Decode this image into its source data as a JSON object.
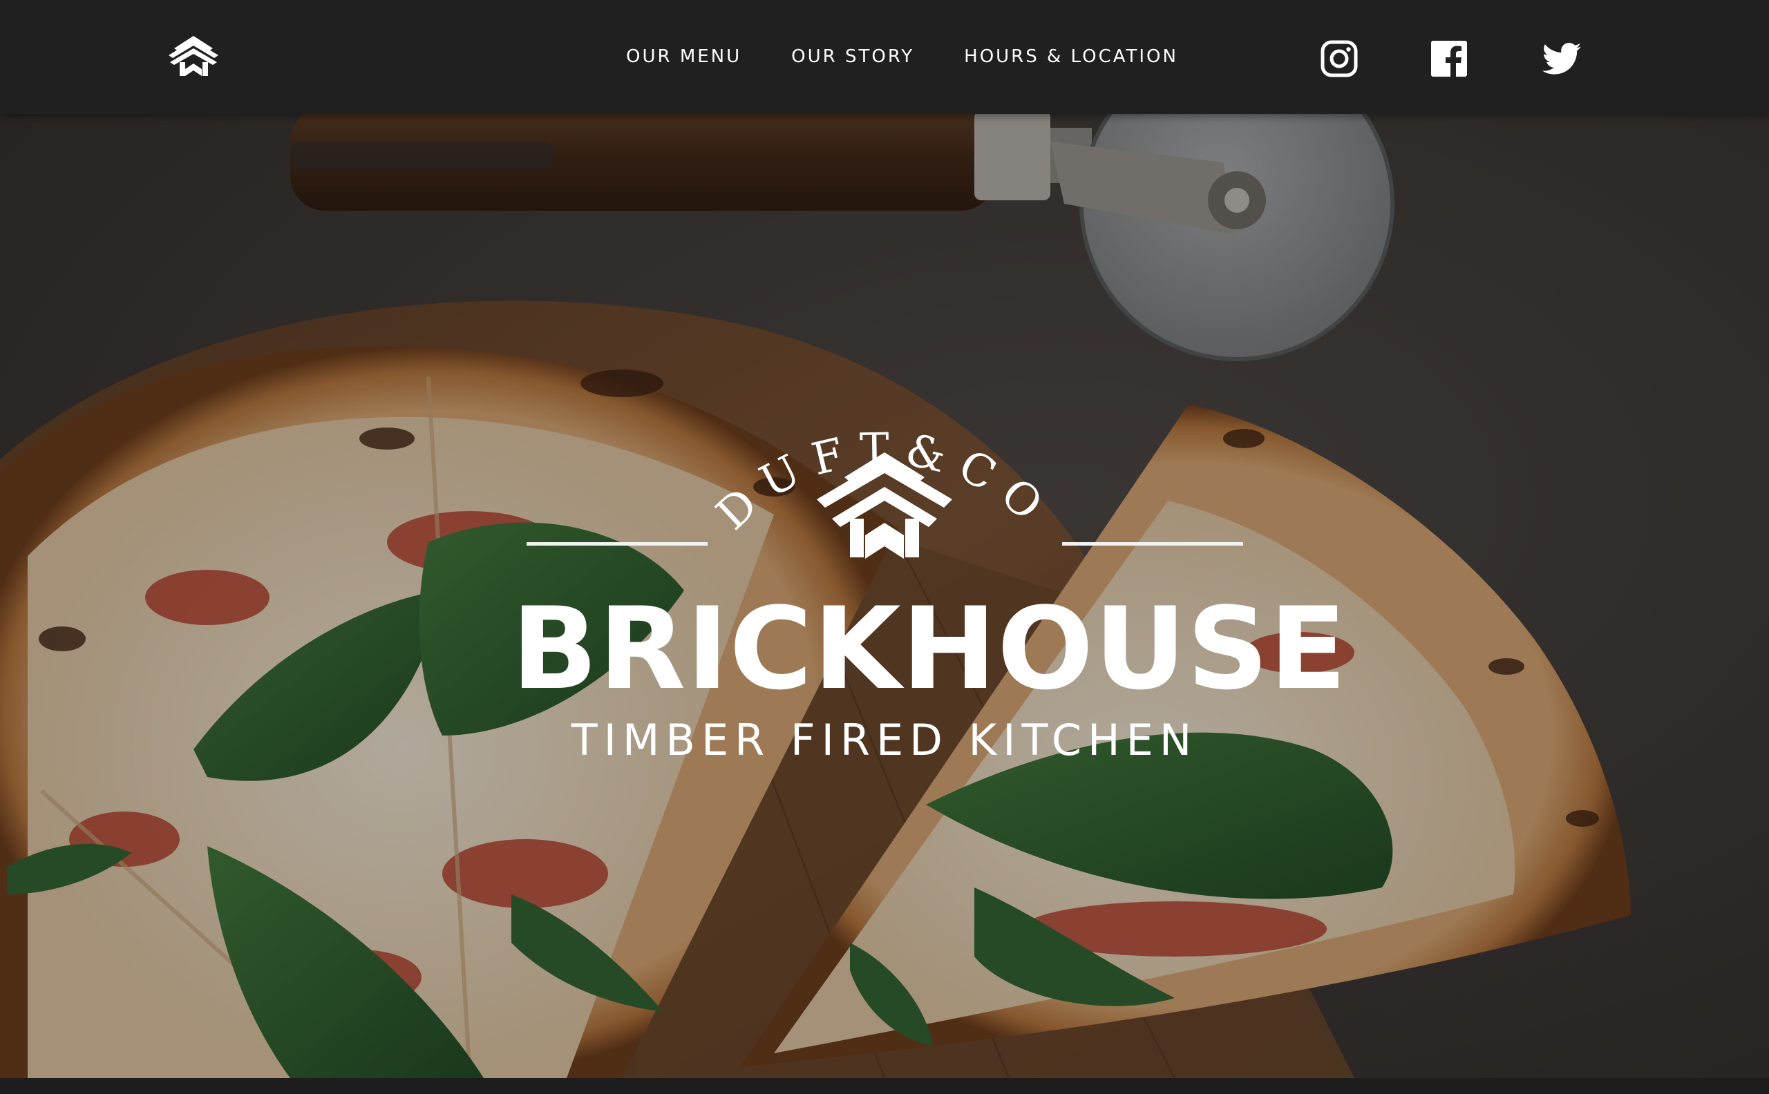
{
  "header": {
    "logo_icon": "brickhouse-chevron-logo-icon",
    "nav": [
      {
        "label": "OUR MENU"
      },
      {
        "label": "OUR STORY"
      },
      {
        "label": "HOURS & LOCATION"
      }
    ],
    "social": [
      {
        "icon": "instagram-icon"
      },
      {
        "icon": "facebook-icon"
      },
      {
        "icon": "twitter-icon"
      }
    ]
  },
  "hero": {
    "arc_text": "DUFT&CO",
    "brand_name": "BRICKHOUSE",
    "tagline": "TIMBER FIRED KITCHEN",
    "background_icon": "pizza-photo"
  },
  "colors": {
    "header_bg": "#202020",
    "text": "#ffffff",
    "hero_base": "#3a3735"
  }
}
